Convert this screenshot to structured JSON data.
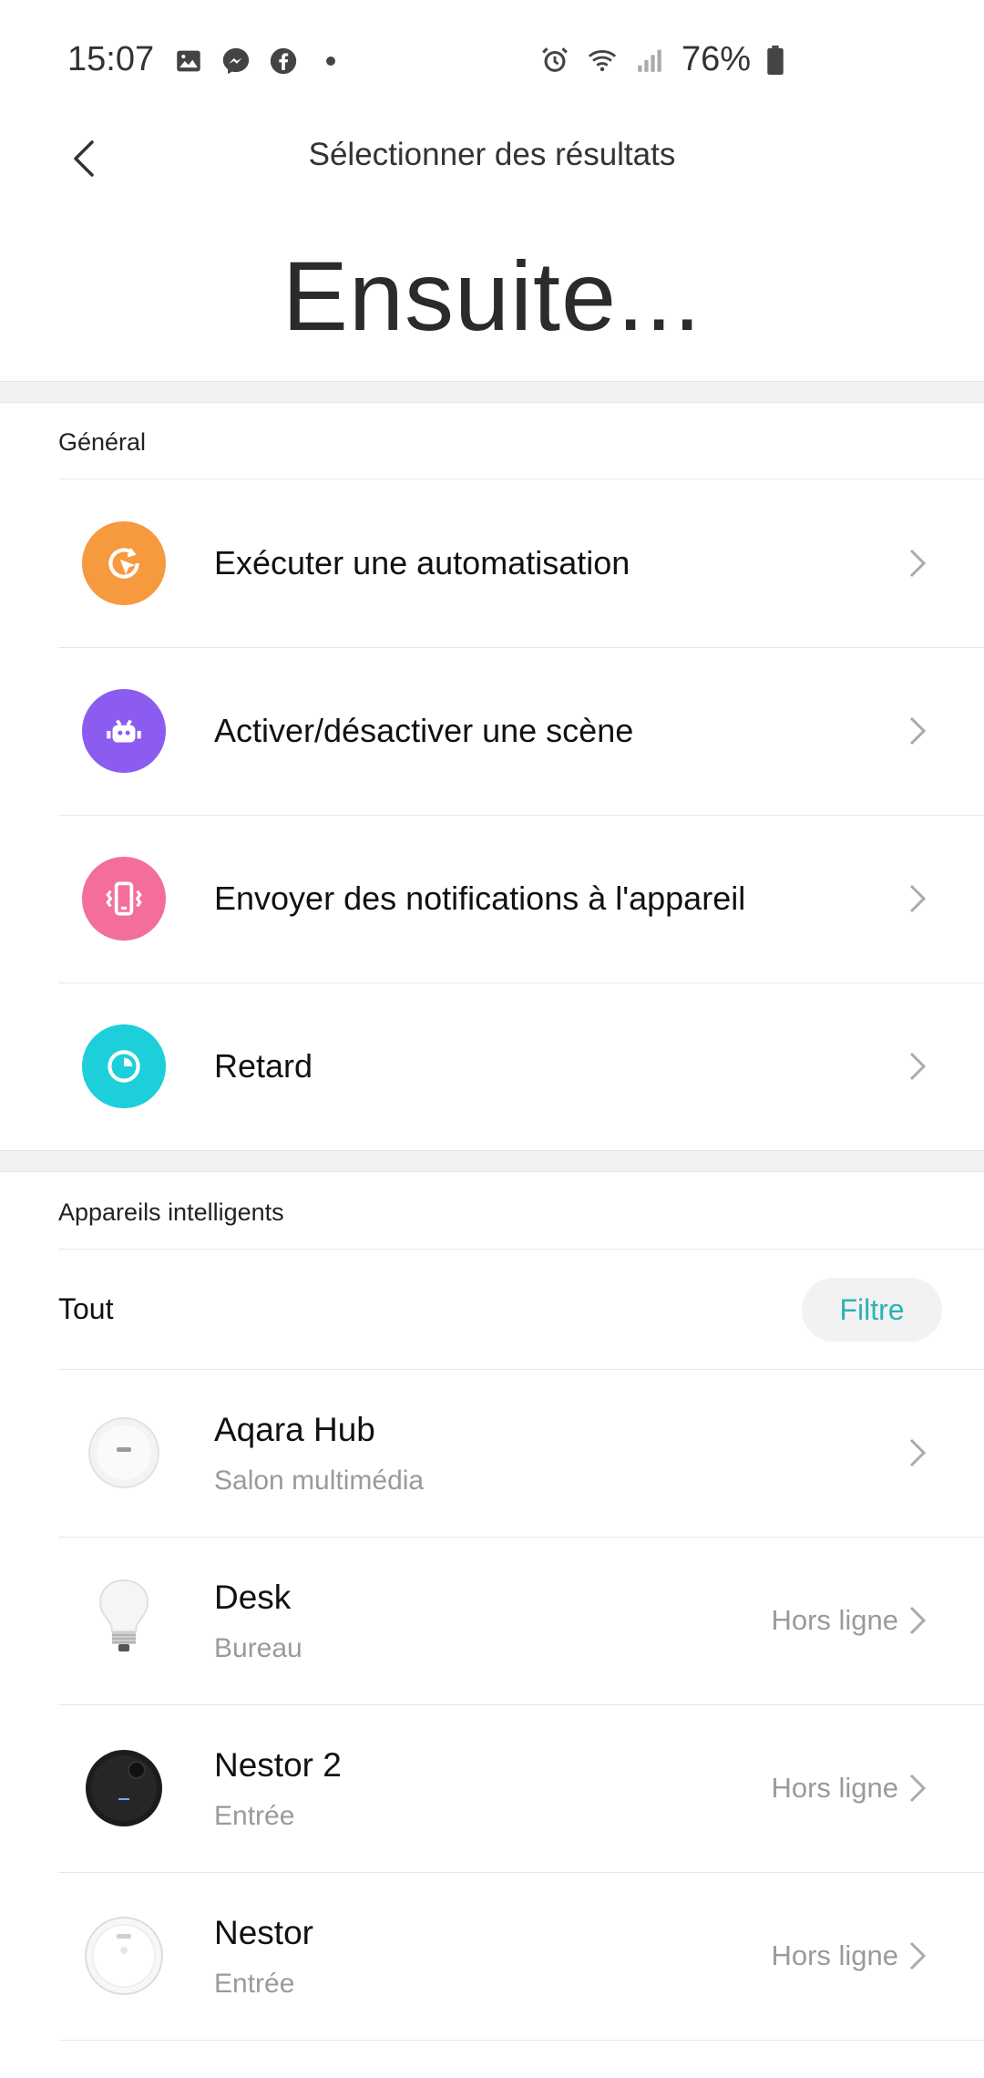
{
  "status_bar": {
    "time": "15:07",
    "left_icons": [
      "gallery-icon",
      "messenger-icon",
      "facebook-icon",
      "dot-icon"
    ],
    "right_icons": [
      "alarm-icon",
      "wifi-icon",
      "signal-icon"
    ],
    "battery": "76%"
  },
  "header": {
    "back_icon": "chevron-left-icon",
    "title": "Sélectionner des résultats",
    "big_title": "Ensuite..."
  },
  "general": {
    "label": "Général",
    "items": [
      {
        "label": "Exécuter une automatisation",
        "icon": "automation-cursor-icon",
        "color": "#f7993f"
      },
      {
        "label": "Activer/désactiver une scène",
        "icon": "scene-robot-icon",
        "color": "#8c5cf0"
      },
      {
        "label": "Envoyer des notifications à l'appareil",
        "icon": "phone-vibrate-icon",
        "color": "#f36f9a"
      },
      {
        "label": "Retard",
        "icon": "timer-icon",
        "color": "#1ccfdb"
      }
    ]
  },
  "smart_devices": {
    "label": "Appareils intelligents",
    "filter_all": "Tout",
    "filter_button": "Filtre",
    "accent": "#2bb3b6",
    "devices": [
      {
        "name": "Aqara Hub",
        "room": "Salon multimédia",
        "status": "",
        "icon": "hub-device-icon"
      },
      {
        "name": "Desk",
        "room": "Bureau",
        "status": "Hors ligne",
        "icon": "light-bulb-icon"
      },
      {
        "name": "Nestor 2",
        "room": "Entrée",
        "status": "Hors ligne",
        "icon": "robot-vacuum-black-icon"
      },
      {
        "name": "Nestor",
        "room": "Entrée",
        "status": "Hors ligne",
        "icon": "robot-vacuum-white-icon"
      }
    ]
  }
}
